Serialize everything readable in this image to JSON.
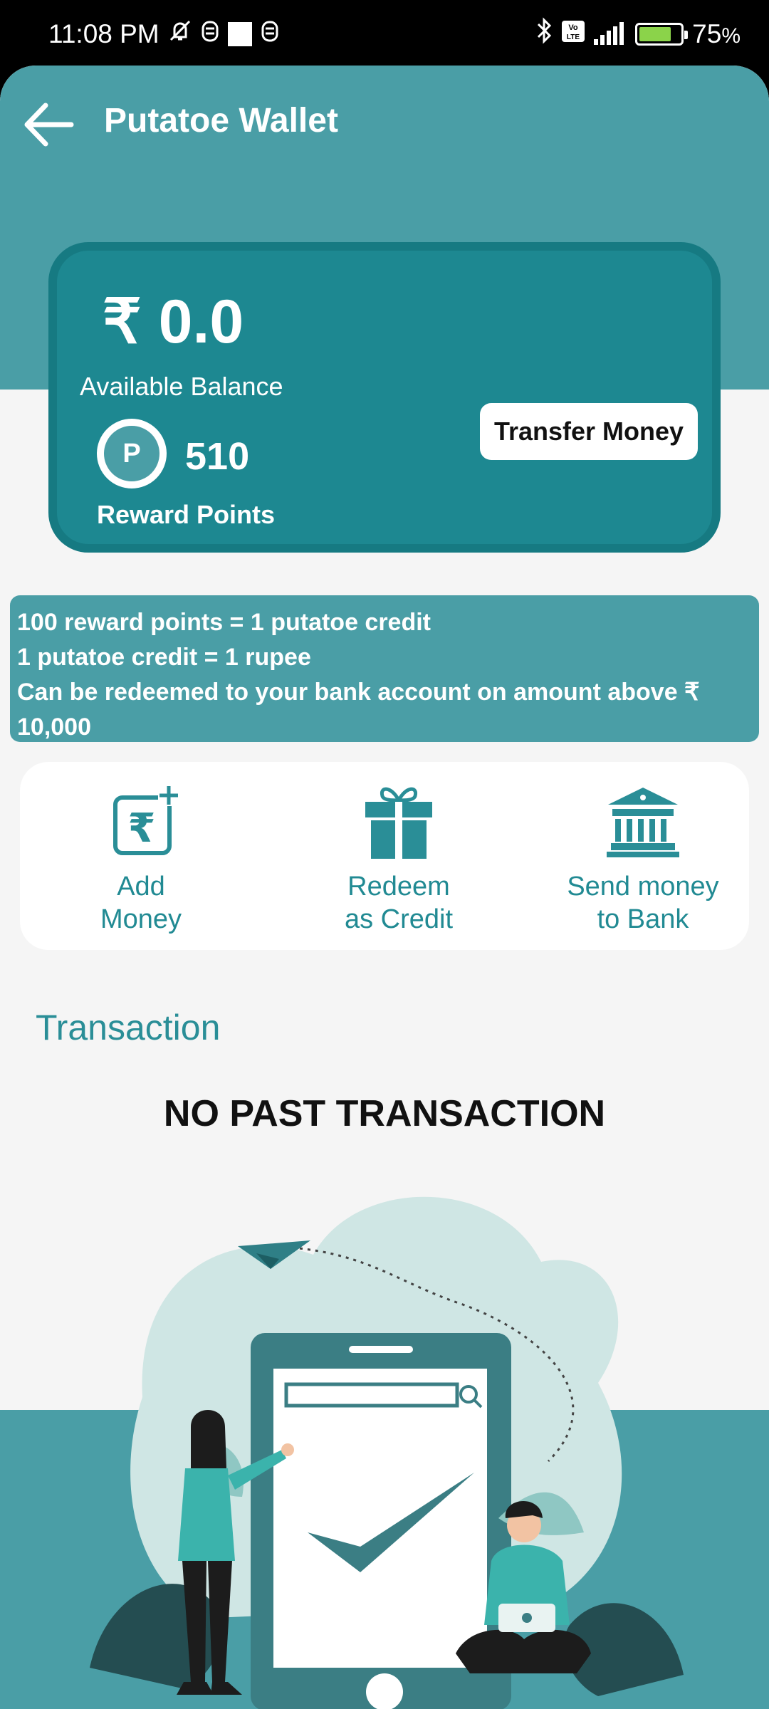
{
  "status_bar": {
    "time": "11:08 PM",
    "battery_percent": "75",
    "battery_symbol": "%"
  },
  "header": {
    "title": "Putatoe Wallet"
  },
  "wallet": {
    "balance": "₹ 0.0",
    "balance_label": "Available Balance",
    "points_icon_letter": "P",
    "reward_points": "510",
    "reward_points_label": "Reward Points",
    "transfer_button": "Transfer Money"
  },
  "info": {
    "lines": [
      "100 reward points = 1 putatoe credit",
      "1 putatoe credit = 1 rupee",
      "Can be redeemed to your bank account on amount above ₹ 10,000"
    ]
  },
  "actions": [
    {
      "label": "Add\nMoney",
      "icon": "rupee-add-icon"
    },
    {
      "label": "Redeem\nas Credit",
      "icon": "gift-icon"
    },
    {
      "label": "Send money\nto Bank",
      "icon": "bank-icon"
    }
  ],
  "transactions": {
    "heading": "Transaction",
    "empty_message": "NO PAST TRANSACTION"
  },
  "colors": {
    "header": "#4a9ea6",
    "card": "#1d8891",
    "accent_text": "#218a93"
  }
}
